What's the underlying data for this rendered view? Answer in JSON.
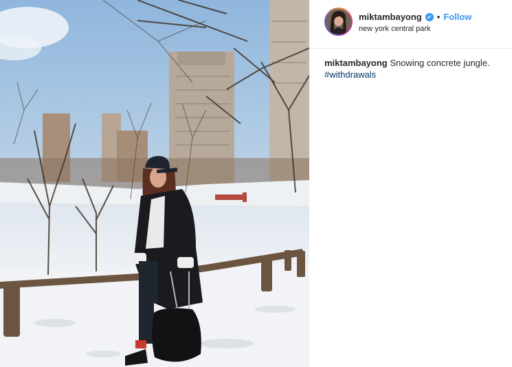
{
  "post": {
    "username": "miktambayong",
    "verified_icon": "verified-badge-icon",
    "separator": "•",
    "follow_label": "Follow",
    "location": "new york central park",
    "caption_username": "miktambayong",
    "caption_text": "Snowing concrete jungle.",
    "hashtag": "#withdrawals"
  },
  "colors": {
    "link_blue": "#3897f0",
    "hashtag_blue": "#003569",
    "text": "#262626"
  }
}
